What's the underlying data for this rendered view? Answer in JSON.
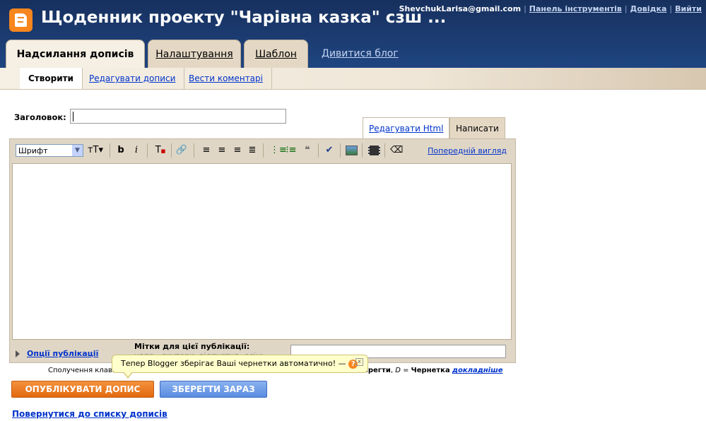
{
  "header": {
    "blog_title": "Щоденник проекту \"Чарівна казка\" сзш ...",
    "user_email": "ShevchukLarisa@gmail.com",
    "links": [
      "Панель інструментів",
      "Довідка",
      "Вийти"
    ]
  },
  "tabs": {
    "posting": "Надсилання дописів",
    "settings": "Налаштування",
    "template": "Шаблон",
    "view_blog": "Дивитися блог"
  },
  "subtabs": {
    "create": "Створити",
    "edit_posts": "Редагувати дописи",
    "moderate": "Вести коментарі"
  },
  "post": {
    "title_label": "Заголовок:",
    "title_value": ""
  },
  "editor": {
    "tab_html": "Редагувати Html",
    "tab_compose": "Написати",
    "font_select": "Шрифт",
    "preview": "Попередній вигляд",
    "body": ""
  },
  "options": {
    "post_options": "Опції публікації",
    "labels_title": "Мітки для цієї публікації:",
    "labels_hint": "напр., скутери, відпустка, осінь"
  },
  "shortcuts": {
    "prefix": "Сполучення клаві",
    "suffix_save": "Зберегти",
    "suffix_draft_key": "D",
    "suffix_draft_label": "Чернетка",
    "more": "докладніше"
  },
  "tooltip": {
    "text": "Тепер Blogger зберігає Ваші чернетки автоматично!",
    "help_symbol": "?",
    "close_symbol": "x"
  },
  "buttons": {
    "publish": "ОПУБЛІКУВАТИ ДОПИС",
    "save": "ЗБЕРЕГТИ ЗАРАЗ"
  },
  "back_link": "Повернутися до списку дописів",
  "colors": {
    "header_bg": "#1f4581",
    "tab_bg": "#e4d8c5",
    "publish_btn": "#f4923d",
    "save_btn": "#6a99e6",
    "link": "#0033cc",
    "logo": "#f7861e"
  }
}
